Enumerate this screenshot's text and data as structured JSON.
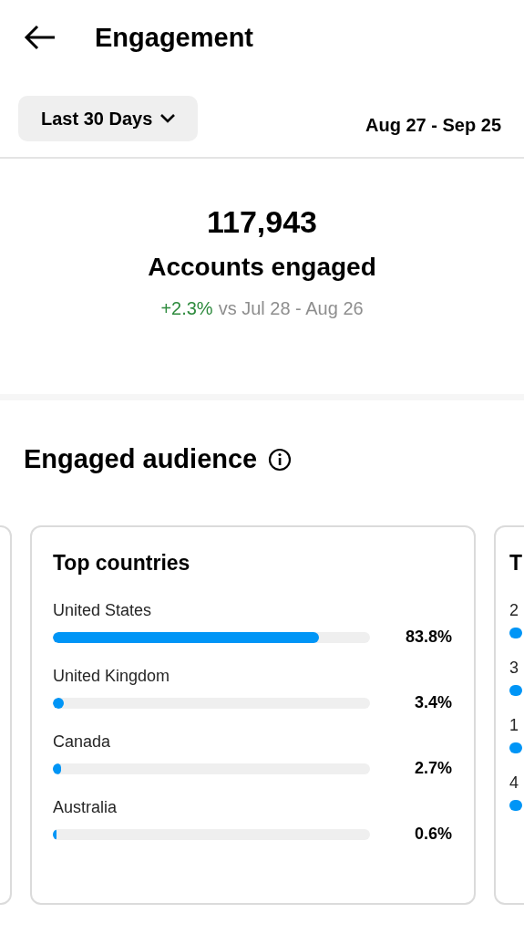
{
  "header": {
    "title": "Engagement"
  },
  "filter": {
    "label": "Last 30 Days",
    "date_range": "Aug 27 - Sep 25"
  },
  "summary": {
    "value": "117,943",
    "label": "Accounts engaged",
    "change": "+2.3%",
    "comparison": "vs Jul 28 - Aug 26"
  },
  "section": {
    "title": "Engaged audience"
  },
  "cards": [
    {
      "title": "Top countries",
      "rows": [
        {
          "label": "United States",
          "level": 0.838,
          "value": "83.8%"
        },
        {
          "label": "United Kingdom",
          "level": 0.034,
          "value": "3.4%"
        },
        {
          "label": "Canada",
          "level": 0.027,
          "value": "2.7%"
        },
        {
          "label": "Australia",
          "level": 0.006,
          "value": "0.6%"
        }
      ]
    },
    {
      "title": "T",
      "rows": [
        {
          "label": "2"
        },
        {
          "label": "3"
        },
        {
          "label": "1"
        },
        {
          "label": "4"
        }
      ]
    }
  ]
}
